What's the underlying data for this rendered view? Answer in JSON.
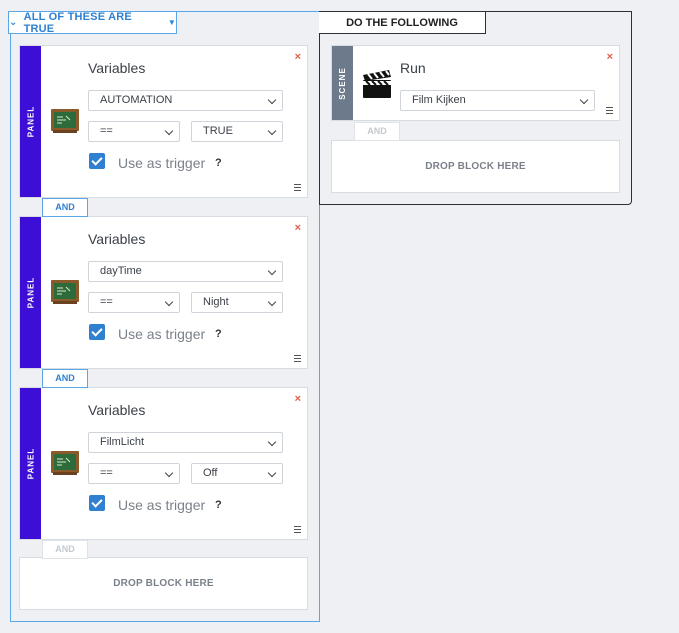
{
  "conditions": {
    "group_label": "ALL OF THESE ARE TRUE",
    "blocks": [
      {
        "type_label": "PANEL",
        "title": "Variables",
        "variable": "AUTOMATION",
        "operator": "==",
        "value": "TRUE",
        "trigger_label": "Use as trigger",
        "help": "?",
        "remove": "×",
        "trigger_checked": true
      },
      {
        "type_label": "PANEL",
        "title": "Variables",
        "variable": "dayTime",
        "operator": "==",
        "value": "Night",
        "trigger_label": "Use as trigger",
        "help": "?",
        "remove": "×",
        "trigger_checked": true
      },
      {
        "type_label": "PANEL",
        "title": "Variables",
        "variable": "FilmLicht",
        "operator": "==",
        "value": "Off",
        "trigger_label": "Use as trigger",
        "help": "?",
        "remove": "×",
        "trigger_checked": true
      }
    ],
    "and_labels": [
      "AND",
      "AND",
      "AND"
    ],
    "drop_label": "DROP BLOCK HERE"
  },
  "actions": {
    "group_label": "DO THE FOLLOWING",
    "blocks": [
      {
        "type_label": "SCENE",
        "title": "Run",
        "scene": "Film Kijken",
        "remove": "×"
      }
    ],
    "and_label": "AND",
    "drop_label": "DROP BLOCK HERE"
  },
  "colors": {
    "panel_stripe": "#3d0fd6",
    "scene_stripe": "#6d7a8c",
    "accent": "#2f80d0",
    "remove": "#e35d4a"
  },
  "icons": {
    "panel": "chalkboard-icon",
    "scene": "clapperboard-icon"
  }
}
